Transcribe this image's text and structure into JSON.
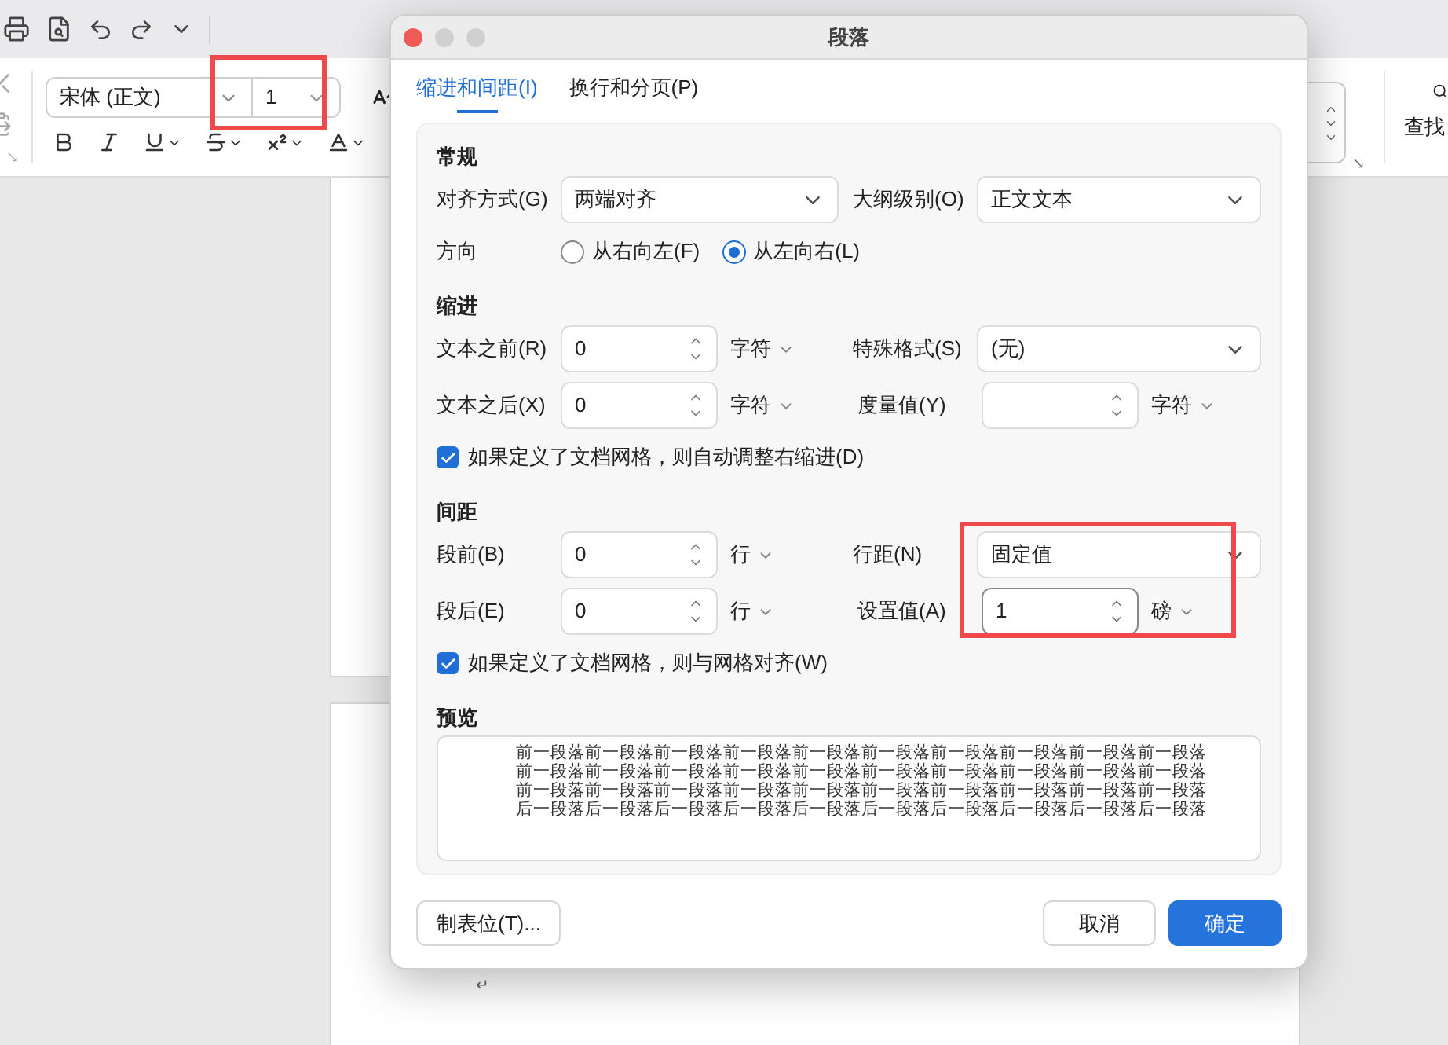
{
  "ribbon": {
    "font_name": "宋体 (正文)",
    "font_size": "1",
    "font_size_highlighted": true,
    "find_label": "查找"
  },
  "document": {
    "paragraph_mark": "↵"
  },
  "dialog": {
    "title": "段落",
    "line_spacing_highlighted": true,
    "tabs": [
      {
        "label": "缩进和间距(I)",
        "selected": true
      },
      {
        "label": "换行和分页(P)",
        "selected": false
      }
    ],
    "sections": [
      {
        "title": "常规",
        "rows": [
          {
            "kind": "fields",
            "cells": [
              {
                "label": "对齐方式(G)",
                "control": {
                  "kind": "dropdown",
                  "value": "两端对齐"
                }
              },
              {
                "label": "大纲级别(O)",
                "control": {
                  "kind": "dropdown",
                  "value": "正文文本"
                }
              }
            ]
          },
          {
            "kind": "radios",
            "label": "方向",
            "options": [
              {
                "label": "从右向左(F)",
                "selected": false
              },
              {
                "label": "从左向右(L)",
                "selected": true
              }
            ]
          }
        ]
      },
      {
        "title": "缩进",
        "rows": [
          {
            "kind": "fields",
            "cells": [
              {
                "label": "文本之前(R)",
                "control": {
                  "kind": "spin",
                  "value": "0",
                  "unit": "字符",
                  "focused": false
                }
              },
              {
                "label": "特殊格式(S)",
                "control": {
                  "kind": "dropdown",
                  "value": "(无)"
                }
              }
            ]
          },
          {
            "kind": "fields",
            "cells": [
              {
                "label": "文本之后(X)",
                "control": {
                  "kind": "spin",
                  "value": "0",
                  "unit": "字符",
                  "focused": false
                }
              },
              {
                "label": "度量值(Y)",
                "control": {
                  "kind": "spin",
                  "unit": "字符",
                  "focused": false
                }
              }
            ]
          },
          {
            "kind": "checkbox",
            "label": "如果定义了文档网格，则自动调整右缩进(D)",
            "checked": true
          }
        ]
      },
      {
        "title": "间距",
        "rows": [
          {
            "kind": "fields",
            "cells": [
              {
                "label": "段前(B)",
                "control": {
                  "kind": "spin",
                  "value": "0",
                  "unit": "行",
                  "focused": false
                }
              },
              {
                "label": "行距(N)",
                "control": {
                  "kind": "dropdown",
                  "value": "固定值"
                }
              }
            ]
          },
          {
            "kind": "fields",
            "cells": [
              {
                "label": "段后(E)",
                "control": {
                  "kind": "spin",
                  "value": "0",
                  "unit": "行",
                  "focused": false
                }
              },
              {
                "label": "设置值(A)",
                "control": {
                  "kind": "spin",
                  "value": "1",
                  "unit": "磅",
                  "focused": true
                }
              }
            ]
          },
          {
            "kind": "checkbox",
            "label": "如果定义了文档网格，则与网格对齐(W)",
            "checked": true
          }
        ]
      }
    ],
    "preview": {
      "title": "预览",
      "lines": [
        "前一段落前一段落前一段落前一段落前一段落前一段落前一段落前一段落前一段落前一段落",
        "前一段落前一段落前一段落前一段落前一段落前一段落前一段落前一段落前一段落前一段落",
        "前一段落前一段落前一段落前一段落前一段落前一段落前一段落前一段落前一段落前一段落",
        "后一段落后一段落后一段落后一段落后一段落后一段落后一段落后一段落后一段落后一段落"
      ]
    },
    "tabs_button": "制表位(T)...",
    "buttons": [
      {
        "label": "取消",
        "kind": "secondary"
      },
      {
        "label": "确定",
        "kind": "primary"
      }
    ]
  }
}
